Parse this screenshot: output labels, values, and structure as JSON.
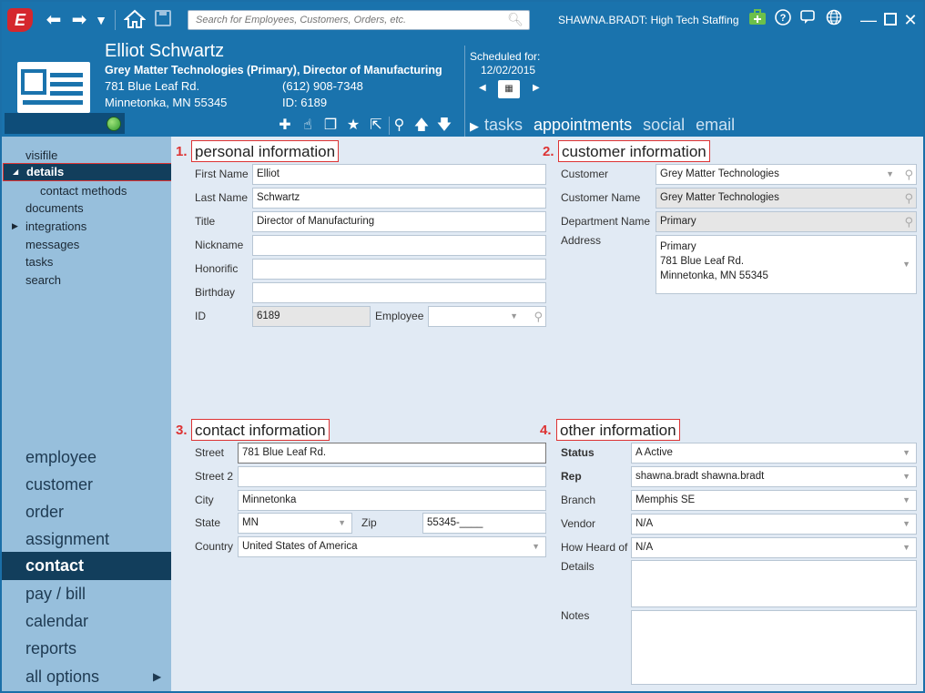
{
  "titlebar": {
    "logo_letter": "E",
    "search_placeholder": "Search for Employees, Customers, Orders, etc.",
    "user": "SHAWNA.BRADT: High Tech Staffing"
  },
  "record": {
    "name": "Elliot Schwartz",
    "company_title": "Grey Matter Technologies (Primary), Director of Manufacturing",
    "street": "781 Blue Leaf Rd.",
    "phone": "(612) 908-7348",
    "city_state_zip": "Minnetonka, MN   55345",
    "id_label": "ID:  6189",
    "status_color": "#2e9a2e"
  },
  "schedule": {
    "label": "Scheduled for:",
    "date": "12/02/2015"
  },
  "header_tabs": [
    "tasks",
    "appointments",
    "social",
    "email"
  ],
  "sidebar": {
    "sub_items": [
      "visifile",
      "details",
      "contact methods",
      "documents",
      "integrations",
      "messages",
      "tasks",
      "search"
    ],
    "nav_items": [
      "employee",
      "customer",
      "order",
      "assignment",
      "contact",
      "pay / bill",
      "calendar",
      "reports",
      "all options"
    ]
  },
  "sections": {
    "personal": {
      "num": "1.",
      "title": "personal information",
      "labels": {
        "first_name": "First Name",
        "last_name": "Last Name",
        "title": "Title",
        "nickname": "Nickname",
        "honorific": "Honorific",
        "birthday": "Birthday",
        "id": "ID",
        "employee": "Employee"
      },
      "values": {
        "first_name": "Elliot",
        "last_name": "Schwartz",
        "title": "Director of Manufacturing",
        "nickname": "",
        "honorific": "",
        "birthday": "",
        "id": "6189",
        "employee": ""
      }
    },
    "customer": {
      "num": "2.",
      "title": "customer information",
      "labels": {
        "customer": "Customer",
        "customer_name": "Customer Name",
        "department_name": "Department Name",
        "address": "Address"
      },
      "values": {
        "customer": "Grey Matter Technologies",
        "customer_name": "Grey Matter Technologies",
        "department_name": "Primary",
        "address_line1": "Primary",
        "address_line2": "781 Blue Leaf Rd.",
        "address_line3": "Minnetonka, MN 55345"
      }
    },
    "contact": {
      "num": "3.",
      "title": "contact information",
      "labels": {
        "street": "Street",
        "street2": "Street 2",
        "city": "City",
        "state": "State",
        "zip": "Zip",
        "country": "Country"
      },
      "values": {
        "street": "781 Blue Leaf Rd.",
        "street2": "",
        "city": "Minnetonka",
        "state": "MN",
        "zip": "55345-____",
        "country": "United States of America"
      }
    },
    "other": {
      "num": "4.",
      "title": "other information",
      "labels": {
        "status": "Status",
        "rep": "Rep",
        "branch": "Branch",
        "vendor": "Vendor",
        "how_heard": "How Heard of",
        "details": "Details",
        "notes": "Notes"
      },
      "values": {
        "status": "A  Active",
        "rep": "shawna.bradt  shawna.bradt",
        "branch": "Memphis SE",
        "vendor": "N/A",
        "how_heard": "N/A",
        "details": "",
        "notes": ""
      }
    }
  },
  "colors": {
    "header_blue": "#1a73ad",
    "dark_nav": "#123e5c",
    "sidebar_blue": "#97bfdc",
    "highlight_red": "#dd3333"
  }
}
